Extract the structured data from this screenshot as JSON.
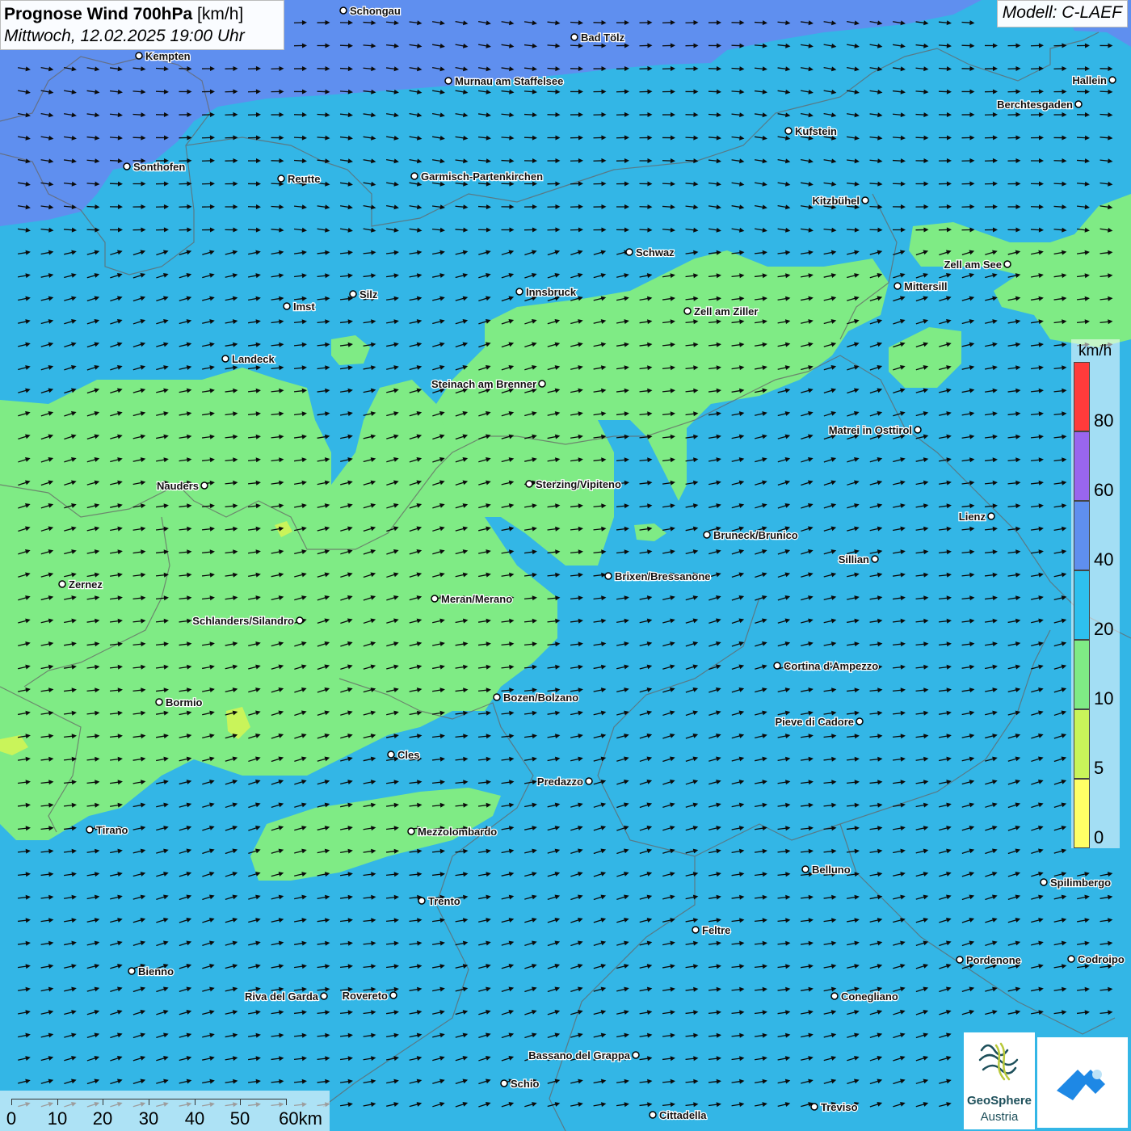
{
  "title": {
    "main": "Prognose Wind 700hPa",
    "unit": "[km/h]",
    "date": "Mittwoch, 12.02.2025 19:00 Uhr"
  },
  "model": "Modell: C-LAEF",
  "legend": {
    "unit": "km/h",
    "labels": [
      "80",
      "60",
      "40",
      "20",
      "10",
      "5",
      "0"
    ],
    "colors": [
      "#ff3b3b",
      "#9966ee",
      "#5f8fef",
      "#2ec0ee",
      "#7feb85",
      "#c9f45a",
      "#ffff66"
    ]
  },
  "colors": {
    "wind_0_5": "#ffff66",
    "wind_5_10": "#c9f45a",
    "wind_10_20": "#7feb85",
    "wind_20_40": "#33b6e6",
    "wind_40_60": "#5f8fef",
    "arrow": "#0b0b0b"
  },
  "scalebar": {
    "labels": [
      "0",
      "10",
      "20",
      "30",
      "40",
      "50",
      "60km"
    ]
  },
  "cities": [
    {
      "name": "Schongau"
    },
    {
      "name": "Bad Tölz"
    },
    {
      "name": "Kempten"
    },
    {
      "name": "Murnau am Staffelsee"
    },
    {
      "name": "Hallein"
    },
    {
      "name": "Berchtesgaden"
    },
    {
      "name": "Kufstein"
    },
    {
      "name": "Sonthofen"
    },
    {
      "name": "Reutte"
    },
    {
      "name": "Garmisch-Partenkirchen"
    },
    {
      "name": "Kitzbühel"
    },
    {
      "name": "Schwaz"
    },
    {
      "name": "Zell am See"
    },
    {
      "name": "Mittersill"
    },
    {
      "name": "Innsbruck"
    },
    {
      "name": "Silz"
    },
    {
      "name": "Imst"
    },
    {
      "name": "Zell am Ziller"
    },
    {
      "name": "Landeck"
    },
    {
      "name": "Steinach am Brenner"
    },
    {
      "name": "Matrei in Osttirol"
    },
    {
      "name": "Nauders"
    },
    {
      "name": "Sterzing/Vipiteno"
    },
    {
      "name": "Lienz"
    },
    {
      "name": "Bruneck/Brunico"
    },
    {
      "name": "Sillian"
    },
    {
      "name": "Brixen/Bressanone"
    },
    {
      "name": "Zernez"
    },
    {
      "name": "Meran/Merano"
    },
    {
      "name": "Schlanders/Silandro"
    },
    {
      "name": "Cortina d'Ampezzo"
    },
    {
      "name": "Bozen/Bolzano"
    },
    {
      "name": "Bormio"
    },
    {
      "name": "Pieve di Cadore"
    },
    {
      "name": "Cles"
    },
    {
      "name": "Predazzo"
    },
    {
      "name": "Tirano"
    },
    {
      "name": "Mezzolombardo"
    },
    {
      "name": "Belluno"
    },
    {
      "name": "Spilimbergo"
    },
    {
      "name": "Trento"
    },
    {
      "name": "Feltre"
    },
    {
      "name": "Pordenone"
    },
    {
      "name": "Codroipo"
    },
    {
      "name": "Bienno"
    },
    {
      "name": "Riva del Garda"
    },
    {
      "name": "Rovereto"
    },
    {
      "name": "Conegliano"
    },
    {
      "name": "Bassano del Grappa"
    },
    {
      "name": "Schio"
    },
    {
      "name": "Treviso"
    },
    {
      "name": "Cittadella"
    }
  ],
  "logos": {
    "geosphere_line1": "GeoSphere",
    "geosphere_line2": "Austria"
  }
}
